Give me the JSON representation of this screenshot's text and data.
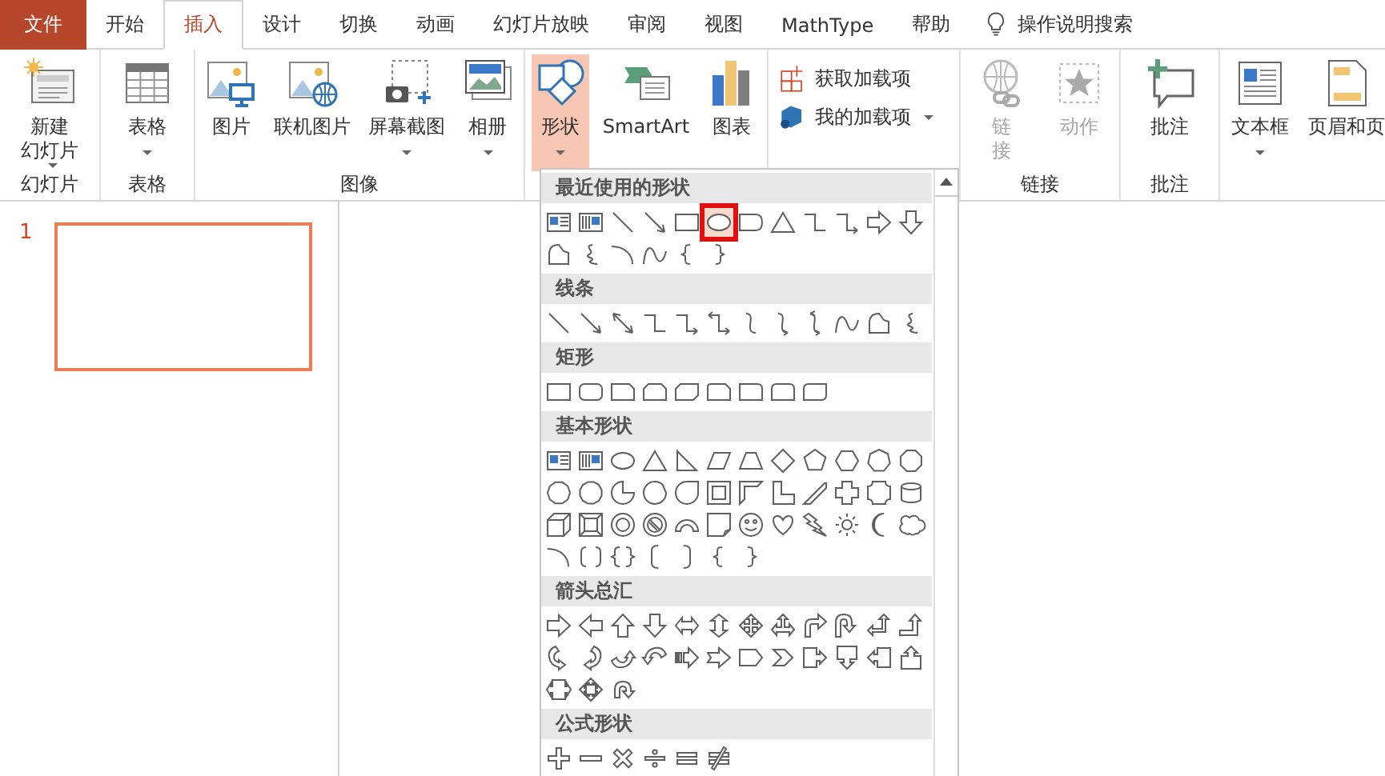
{
  "tabs": [
    {
      "label": "文件",
      "kind": "file",
      "selected": false
    },
    {
      "label": "开始",
      "kind": "tab",
      "selected": false
    },
    {
      "label": "插入",
      "kind": "tab",
      "selected": true
    },
    {
      "label": "设计",
      "kind": "tab",
      "selected": false
    },
    {
      "label": "切换",
      "kind": "tab",
      "selected": false
    },
    {
      "label": "动画",
      "kind": "tab",
      "selected": false
    },
    {
      "label": "幻灯片放映",
      "kind": "tab",
      "selected": false
    },
    {
      "label": "审阅",
      "kind": "tab",
      "selected": false
    },
    {
      "label": "视图",
      "kind": "tab",
      "selected": false
    },
    {
      "label": "MathType",
      "kind": "tab",
      "selected": false
    },
    {
      "label": "帮助",
      "kind": "tab",
      "selected": false
    }
  ],
  "tell_me": {
    "label": "操作说明搜索"
  },
  "ribbon": {
    "groups": [
      {
        "label": "幻灯片",
        "buttons": [
          {
            "kind": "large",
            "lines": [
              "新建",
              "幻灯片"
            ],
            "dropdown": true,
            "selected": false,
            "disabled": false
          }
        ]
      },
      {
        "label": "表格",
        "buttons": [
          {
            "kind": "large",
            "lines": [
              "表格"
            ],
            "dropdown": true,
            "selected": false,
            "disabled": false
          }
        ]
      },
      {
        "label": "图像",
        "buttons": [
          {
            "kind": "large",
            "lines": [
              "图片"
            ],
            "dropdown": false,
            "selected": false,
            "disabled": false
          },
          {
            "kind": "large",
            "lines": [
              "联机图片"
            ],
            "dropdown": false,
            "selected": false,
            "disabled": false
          },
          {
            "kind": "large",
            "lines": [
              "屏幕截图"
            ],
            "dropdown": true,
            "selected": false,
            "disabled": false
          },
          {
            "kind": "large",
            "lines": [
              "相册"
            ],
            "dropdown": true,
            "selected": false,
            "disabled": false
          }
        ]
      },
      {
        "buttons": [
          {
            "kind": "large",
            "lines": [
              "形状"
            ],
            "dropdown": true,
            "selected": true,
            "disabled": false
          },
          {
            "kind": "large",
            "lines": [
              "SmartArt"
            ],
            "dropdown": false,
            "selected": false,
            "disabled": false
          },
          {
            "kind": "large",
            "lines": [
              "图表"
            ],
            "dropdown": false,
            "selected": false,
            "disabled": false
          }
        ]
      },
      {
        "buttons": [
          {
            "kind": "small",
            "lines": [
              "获取加载项"
            ],
            "dropdown": false,
            "selected": false,
            "disabled": false
          },
          {
            "kind": "small",
            "lines": [
              "我的加载项"
            ],
            "dropdown": true,
            "selected": false,
            "disabled": false
          }
        ]
      },
      {
        "label": "链接",
        "buttons": [
          {
            "kind": "large",
            "lines": [
              "链",
              "接"
            ],
            "dropdown": false,
            "selected": false,
            "disabled": true
          },
          {
            "kind": "large",
            "lines": [
              "动作"
            ],
            "dropdown": false,
            "selected": false,
            "disabled": true
          }
        ]
      },
      {
        "label": "批注",
        "buttons": [
          {
            "kind": "large",
            "lines": [
              "批注"
            ],
            "dropdown": false,
            "selected": false,
            "disabled": false
          }
        ]
      },
      {
        "buttons": [
          {
            "kind": "large",
            "lines": [
              "文本框"
            ],
            "dropdown": true,
            "selected": false,
            "disabled": false
          },
          {
            "kind": "large",
            "lines": [
              "页眉和页"
            ],
            "dropdown": false,
            "selected": false,
            "disabled": false
          }
        ]
      }
    ]
  },
  "slides": [
    {
      "number": "1",
      "selected": true
    }
  ],
  "shape_gallery": {
    "sections": [
      {
        "title": "最近使用的形状",
        "shapes": [
          {
            "kind": "textbox",
            "selected": false
          },
          {
            "kind": "vertical-textbox",
            "selected": false
          },
          {
            "kind": "line",
            "selected": false
          },
          {
            "kind": "arrow-line",
            "selected": false
          },
          {
            "kind": "rectangle",
            "selected": false
          },
          {
            "kind": "ellipse",
            "selected": true
          },
          {
            "kind": "delay",
            "selected": false
          },
          {
            "kind": "triangle",
            "selected": false
          },
          {
            "kind": "elbow-connector",
            "selected": false
          },
          {
            "kind": "elbow-arrow",
            "selected": false
          },
          {
            "kind": "right-arrow",
            "selected": false
          },
          {
            "kind": "down-arrow",
            "selected": false
          },
          {
            "kind": "freeform",
            "selected": false
          },
          {
            "kind": "scribble",
            "selected": false
          },
          {
            "kind": "arc",
            "selected": false
          },
          {
            "kind": "curve",
            "selected": false
          },
          {
            "kind": "left-brace",
            "selected": false
          },
          {
            "kind": "right-brace",
            "selected": false
          }
        ]
      },
      {
        "title": "线条",
        "shapes": [
          {
            "kind": "line",
            "selected": false
          },
          {
            "kind": "arrow-line",
            "selected": false
          },
          {
            "kind": "double-arrow-line",
            "selected": false
          },
          {
            "kind": "elbow-connector",
            "selected": false
          },
          {
            "kind": "elbow-arrow",
            "selected": false
          },
          {
            "kind": "elbow-double-arrow",
            "selected": false
          },
          {
            "kind": "curved-connector",
            "selected": false
          },
          {
            "kind": "curved-arrow",
            "selected": false
          },
          {
            "kind": "curved-double-arrow",
            "selected": false
          },
          {
            "kind": "curve",
            "selected": false
          },
          {
            "kind": "freeform",
            "selected": false
          },
          {
            "kind": "scribble",
            "selected": false
          }
        ]
      },
      {
        "title": "矩形",
        "shapes": [
          {
            "kind": "rectangle",
            "selected": false
          },
          {
            "kind": "rounded-rectangle",
            "selected": false
          },
          {
            "kind": "snip-corner-rectangle",
            "selected": false
          },
          {
            "kind": "snip-same-side-rectangle",
            "selected": false
          },
          {
            "kind": "snip-diagonal-rectangle",
            "selected": false
          },
          {
            "kind": "snip-round-rectangle",
            "selected": false
          },
          {
            "kind": "round-corner-rectangle",
            "selected": false
          },
          {
            "kind": "round-same-side-rectangle",
            "selected": false
          },
          {
            "kind": "round-diagonal-rectangle",
            "selected": false
          }
        ]
      },
      {
        "title": "基本形状",
        "shapes": [
          {
            "kind": "textbox",
            "selected": false
          },
          {
            "kind": "vertical-textbox",
            "selected": false
          },
          {
            "kind": "ellipse",
            "selected": false
          },
          {
            "kind": "triangle",
            "selected": false
          },
          {
            "kind": "right-triangle",
            "selected": false
          },
          {
            "kind": "parallelogram",
            "selected": false
          },
          {
            "kind": "trapezoid",
            "selected": false
          },
          {
            "kind": "diamond",
            "selected": false
          },
          {
            "kind": "pentagon",
            "selected": false
          },
          {
            "kind": "hexagon",
            "selected": false
          },
          {
            "kind": "heptagon",
            "selected": false
          },
          {
            "kind": "octagon",
            "selected": false
          },
          {
            "kind": "decagon",
            "selected": false
          },
          {
            "kind": "dodecagon",
            "selected": false
          },
          {
            "kind": "pie",
            "selected": false
          },
          {
            "kind": "chord",
            "selected": false
          },
          {
            "kind": "teardrop",
            "selected": false
          },
          {
            "kind": "frame",
            "selected": false
          },
          {
            "kind": "half-frame",
            "selected": false
          },
          {
            "kind": "l-shape",
            "selected": false
          },
          {
            "kind": "diagonal-stripe",
            "selected": false
          },
          {
            "kind": "cross",
            "selected": false
          },
          {
            "kind": "plaque",
            "selected": false
          },
          {
            "kind": "can",
            "selected": false
          },
          {
            "kind": "cube",
            "selected": false
          },
          {
            "kind": "bevel",
            "selected": false
          },
          {
            "kind": "donut",
            "selected": false
          },
          {
            "kind": "no-symbol",
            "selected": false
          },
          {
            "kind": "block-arc",
            "selected": false
          },
          {
            "kind": "folded-corner",
            "selected": false
          },
          {
            "kind": "smiley",
            "selected": false
          },
          {
            "kind": "heart",
            "selected": false
          },
          {
            "kind": "lightning",
            "selected": false
          },
          {
            "kind": "sun",
            "selected": false
          },
          {
            "kind": "moon",
            "selected": false
          },
          {
            "kind": "cloud",
            "selected": false
          },
          {
            "kind": "arc",
            "selected": false
          },
          {
            "kind": "bracket-pair",
            "selected": false
          },
          {
            "kind": "brace-pair",
            "selected": false
          },
          {
            "kind": "left-bracket",
            "selected": false
          },
          {
            "kind": "right-bracket",
            "selected": false
          },
          {
            "kind": "left-brace",
            "selected": false
          },
          {
            "kind": "right-brace",
            "selected": false
          }
        ]
      },
      {
        "title": "箭头总汇",
        "shapes": [
          {
            "kind": "right-arrow",
            "selected": false
          },
          {
            "kind": "left-arrow",
            "selected": false
          },
          {
            "kind": "up-arrow",
            "selected": false
          },
          {
            "kind": "down-arrow",
            "selected": false
          },
          {
            "kind": "left-right-arrow",
            "selected": false
          },
          {
            "kind": "up-down-arrow",
            "selected": false
          },
          {
            "kind": "quad-arrow",
            "selected": false
          },
          {
            "kind": "left-right-up-arrow",
            "selected": false
          },
          {
            "kind": "bent-arrow",
            "selected": false
          },
          {
            "kind": "u-turn-arrow",
            "selected": false
          },
          {
            "kind": "left-up-arrow",
            "selected": false
          },
          {
            "kind": "bent-up-arrow",
            "selected": false
          },
          {
            "kind": "curved-right-arrow",
            "selected": false
          },
          {
            "kind": "curved-left-arrow",
            "selected": false
          },
          {
            "kind": "curved-up-arrow",
            "selected": false
          },
          {
            "kind": "curved-down-arrow",
            "selected": false
          },
          {
            "kind": "striped-right-arrow",
            "selected": false
          },
          {
            "kind": "notched-right-arrow",
            "selected": false
          },
          {
            "kind": "pentagon-arrow",
            "selected": false
          },
          {
            "kind": "chevron",
            "selected": false
          },
          {
            "kind": "right-arrow-callout",
            "selected": false
          },
          {
            "kind": "down-arrow-callout",
            "selected": false
          },
          {
            "kind": "left-arrow-callout",
            "selected": false
          },
          {
            "kind": "up-arrow-callout",
            "selected": false
          },
          {
            "kind": "left-right-arrow-callout",
            "selected": false
          },
          {
            "kind": "quad-arrow-callout",
            "selected": false
          },
          {
            "kind": "circular-arrow",
            "selected": false
          }
        ]
      },
      {
        "title": "公式形状",
        "shapes": [
          {
            "kind": "plus",
            "selected": false
          },
          {
            "kind": "minus",
            "selected": false
          },
          {
            "kind": "multiply",
            "selected": false
          },
          {
            "kind": "divide",
            "selected": false
          },
          {
            "kind": "equal",
            "selected": false
          },
          {
            "kind": "not-equal",
            "selected": false
          }
        ]
      }
    ]
  }
}
